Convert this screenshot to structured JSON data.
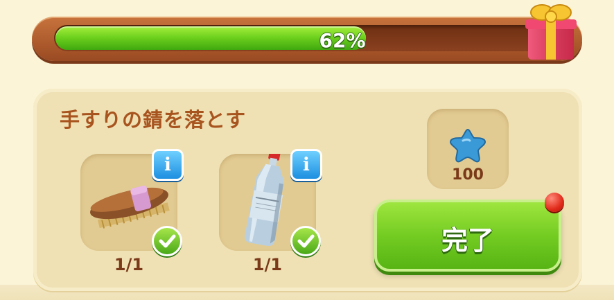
{
  "progress": {
    "percent_value": 0.62,
    "label": "62%"
  },
  "reward_box": {
    "icon": "gift-box-icon"
  },
  "task": {
    "title": "手すりの錆を落とす",
    "items": [
      {
        "icon": "scrub-brush-icon",
        "count": "1/1",
        "completed": true
      },
      {
        "icon": "solvent-bottle-icon",
        "count": "1/1",
        "completed": true
      }
    ],
    "reward": {
      "icon": "blue-star-icon",
      "amount": "100"
    },
    "complete_button_label": "完了",
    "notification": true
  },
  "colors": {
    "progress_fill": "#6fd21e",
    "title_text": "#a8541f",
    "button_green": "#74cc22",
    "info_blue": "#1d8fe0",
    "notify_red": "#e02a1a",
    "star_blue": "#3a9ad8"
  }
}
